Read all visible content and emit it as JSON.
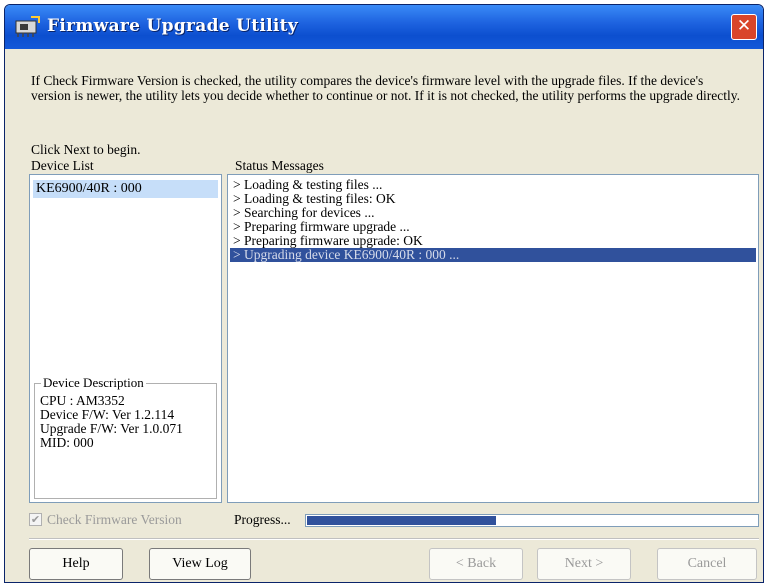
{
  "window": {
    "title": "Firmware Upgrade Utility",
    "close_glyph": "✕"
  },
  "intro_text": "If Check Firmware Version is checked, the utility compares the device's firmware level with the upgrade files. If the device's version is newer, the utility lets you decide whether to continue or not. If it is not checked, the utility performs the upgrade directly.",
  "begin_text": "Click Next to begin.",
  "device_list": {
    "label": "Device List",
    "items": [
      {
        "label": "KE6900/40R : 000",
        "selected": true
      }
    ]
  },
  "device_description": {
    "legend": "Device Description",
    "lines": [
      "CPU : AM3352",
      "Device F/W: Ver 1.2.114",
      "Upgrade F/W: Ver 1.0.071",
      "MID: 000"
    ]
  },
  "status": {
    "label": "Status Messages",
    "messages": [
      {
        "text": "> Loading & testing files ...",
        "selected": false
      },
      {
        "text": "> Loading & testing files: OK",
        "selected": false
      },
      {
        "text": "> Searching for devices ...",
        "selected": false
      },
      {
        "text": "> Preparing firmware upgrade ...",
        "selected": false
      },
      {
        "text": "> Preparing firmware upgrade: OK",
        "selected": false
      },
      {
        "text": "> Upgrading device KE6900/40R : 000 ...",
        "selected": true
      }
    ]
  },
  "check_firmware": {
    "label": "Check Firmware Version",
    "checked": true,
    "enabled": false,
    "check_glyph": "✔"
  },
  "progress": {
    "label": "Progress...",
    "fraction": 0.42
  },
  "buttons": {
    "help": "Help",
    "view_log": "View Log",
    "back": "< Back",
    "next": "Next >",
    "cancel": "Cancel"
  },
  "icons": {
    "app": "firmware-chip-icon",
    "close": "close-icon"
  },
  "colors": {
    "titlebar": "#0c4fcf",
    "selection": "#30519c",
    "close": "#d9452a",
    "window_bg": "#ece9d8"
  }
}
